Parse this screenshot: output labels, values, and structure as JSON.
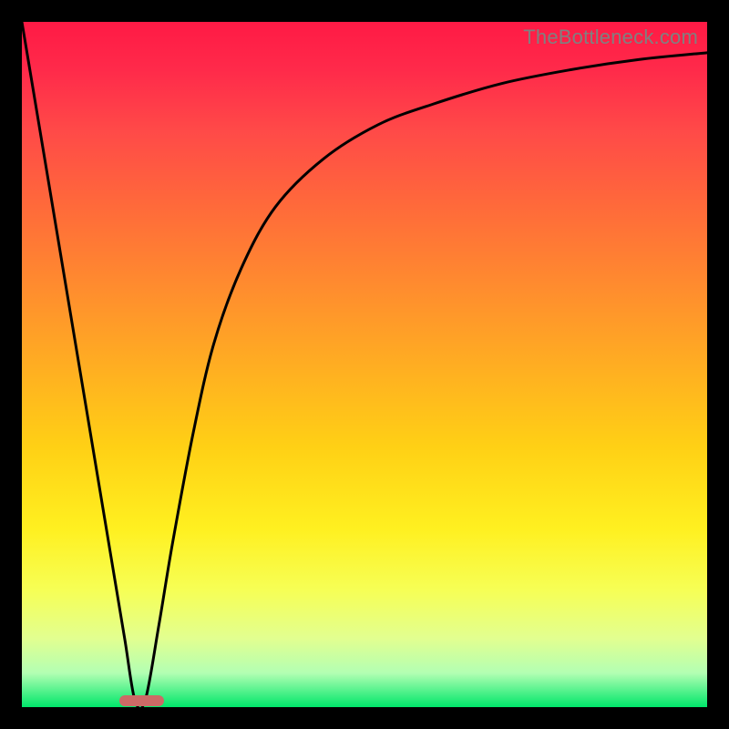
{
  "watermark": "TheBottleneck.com",
  "chart_data": {
    "type": "line",
    "title": "",
    "xlabel": "",
    "ylabel": "",
    "xlim": [
      0,
      100
    ],
    "ylim": [
      0,
      100
    ],
    "grid": false,
    "series": [
      {
        "name": "curve",
        "x": [
          0,
          2,
          5,
          8,
          11,
          13,
          15,
          16.5,
          18,
          20,
          22,
          25,
          28,
          32,
          37,
          44,
          52,
          60,
          70,
          80,
          90,
          100
        ],
        "y": [
          100,
          88,
          70,
          52,
          34,
          22,
          10,
          1,
          1,
          12,
          24,
          40,
          53,
          64,
          73,
          80,
          85,
          88,
          91,
          93,
          94.5,
          95.5
        ]
      }
    ],
    "marker": {
      "x_center_pct": 17.5,
      "width_pct": 6.5,
      "height_pct": 1.6,
      "color": "#cc6a66"
    },
    "gradient_stops": [
      {
        "pct": 0,
        "color": "#ff1a45"
      },
      {
        "pct": 50,
        "color": "#ffad22"
      },
      {
        "pct": 83,
        "color": "#f6ff56"
      },
      {
        "pct": 100,
        "color": "#00e66a"
      }
    ]
  }
}
